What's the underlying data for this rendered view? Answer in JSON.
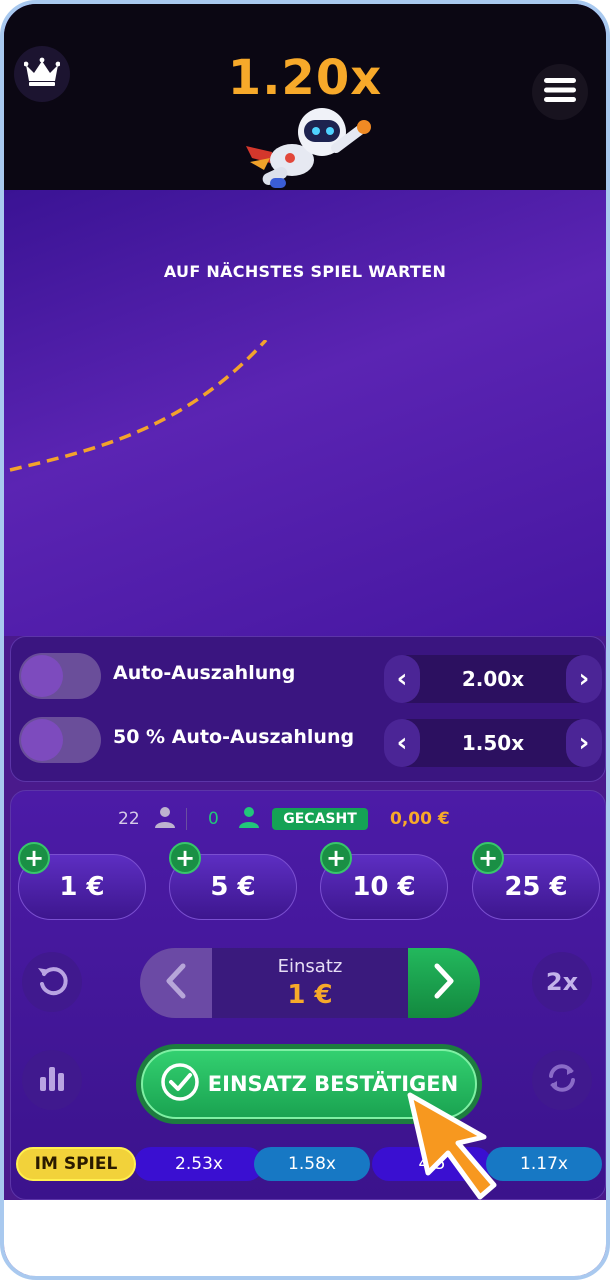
{
  "header": {
    "multiplier": "1.20x",
    "crown_icon": "crown-icon",
    "menu_icon": "hamburger-menu-icon"
  },
  "game": {
    "status": "AUF NÄCHSTES SPIEL WARTEN"
  },
  "auto": {
    "rows": [
      {
        "label": "Auto-Auszahlung",
        "value": "2.00x",
        "enabled": false
      },
      {
        "label": "50 % Auto-Auszahlung",
        "value": "1.50x",
        "enabled": false
      }
    ],
    "prev_glyph": "‹",
    "next_glyph": "›"
  },
  "stats": {
    "players": "22",
    "cashed_count": "0",
    "cashed_label": "GECASHT",
    "cashed_amount": "0,00 €"
  },
  "chips": [
    {
      "label": "1 €",
      "plus": "+"
    },
    {
      "label": "5 €",
      "plus": "+"
    },
    {
      "label": "10 €",
      "plus": "+"
    },
    {
      "label": "25 €",
      "plus": "+"
    }
  ],
  "stake": {
    "label": "Einsatz",
    "value": "1 €",
    "double_label": "2x"
  },
  "confirm": {
    "label": "EINSATZ BESTÄTIGEN"
  },
  "history": {
    "live_label": "IM SPIEL",
    "items": [
      "2.53x",
      "1.58x",
      "4.5",
      "1.17x"
    ]
  },
  "colors": {
    "accent_orange": "#f7a92a",
    "confirm_green": "#22b85c",
    "background_purple": "#4a1a8c"
  }
}
